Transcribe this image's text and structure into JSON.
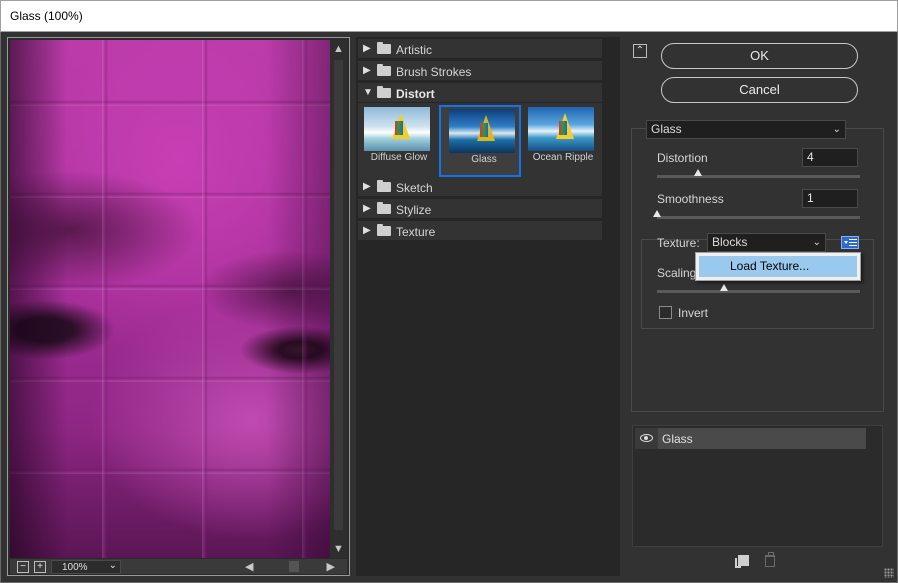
{
  "window": {
    "title": "Glass (100%)"
  },
  "preview": {
    "zoom": "100%"
  },
  "filter_groups": [
    {
      "label": "Artistic",
      "expanded": false
    },
    {
      "label": "Brush Strokes",
      "expanded": false
    },
    {
      "label": "Distort",
      "expanded": true
    },
    {
      "label": "Sketch",
      "expanded": false
    },
    {
      "label": "Stylize",
      "expanded": false
    },
    {
      "label": "Texture",
      "expanded": false
    }
  ],
  "distort_filters": [
    {
      "label": "Diffuse Glow",
      "selected": false
    },
    {
      "label": "Glass",
      "selected": true
    },
    {
      "label": "Ocean Ripple",
      "selected": false
    }
  ],
  "buttons": {
    "ok": "OK",
    "cancel": "Cancel"
  },
  "settings": {
    "filter_select": "Glass",
    "distortion": {
      "label": "Distortion",
      "value": "4",
      "level": 0.2
    },
    "smoothness": {
      "label": "Smoothness",
      "value": "1",
      "level": 0.0
    },
    "texture": {
      "label": "Texture:",
      "value": "Blocks"
    },
    "scaling": {
      "label": "Scaling",
      "level": 0.33
    },
    "invert": {
      "label": "Invert",
      "checked": false
    }
  },
  "texture_menu": {
    "item": "Load Texture..."
  },
  "layers": [
    {
      "name": "Glass",
      "visible": true
    }
  ],
  "colors": {
    "accent": "#1473e6",
    "menu_highlight": "#99c9ef"
  }
}
